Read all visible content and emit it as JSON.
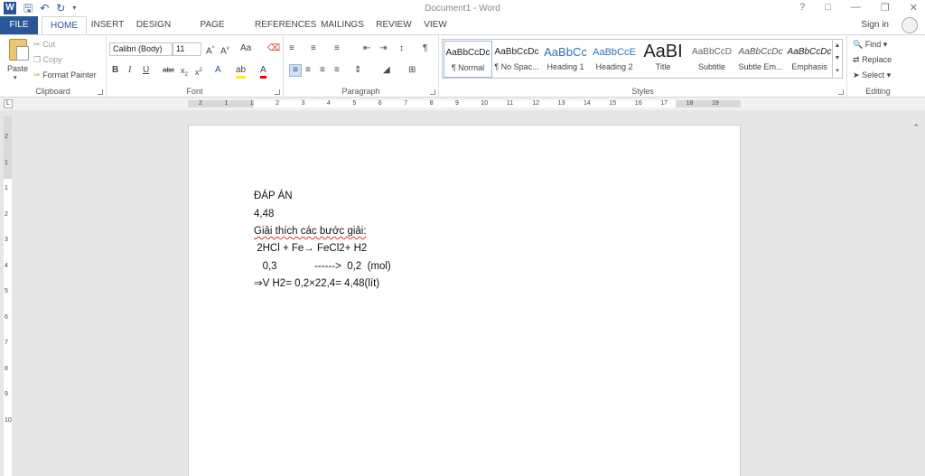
{
  "window": {
    "title": "Document1 - Word",
    "help": "?",
    "sign_in": "Sign in"
  },
  "qat": {
    "app_icon": "W",
    "save_icon": "save-icon",
    "undo_icon": "undo-icon",
    "redo_icon": "redo-icon"
  },
  "tabs": [
    "FILE",
    "HOME",
    "INSERT",
    "DESIGN",
    "PAGE LAYOUT",
    "REFERENCES",
    "MAILINGS",
    "REVIEW",
    "VIEW"
  ],
  "clipboard": {
    "paste": "Paste",
    "cut": "Cut",
    "copy": "Copy",
    "format_painter": "Format Painter",
    "label": "Clipboard"
  },
  "font": {
    "name": "Calibri (Body)",
    "size": "11",
    "label": "Font",
    "change_case": "Aa"
  },
  "paragraph": {
    "label": "Paragraph"
  },
  "styles": {
    "label": "Styles",
    "items": [
      {
        "preview": "AaBbCcDc",
        "name": "¶ Normal"
      },
      {
        "preview": "AaBbCcDc",
        "name": "¶ No Spac..."
      },
      {
        "preview": "AaBbCc",
        "name": "Heading 1"
      },
      {
        "preview": "AaBbCcE",
        "name": "Heading 2"
      },
      {
        "preview": "AaBI",
        "name": "Title"
      },
      {
        "preview": "AaBbCcD",
        "name": "Subtitle"
      },
      {
        "preview": "AaBbCcDc",
        "name": "Subtle Em..."
      },
      {
        "preview": "AaBbCcDc",
        "name": "Emphasis"
      }
    ]
  },
  "editing": {
    "find": "Find",
    "replace": "Replace",
    "select": "Select",
    "label": "Editing"
  },
  "ruler": {
    "ticks": [
      "2",
      "1",
      "1",
      "2",
      "3",
      "4",
      "5",
      "6",
      "7",
      "8",
      "9",
      "10",
      "11",
      "12",
      "13",
      "14",
      "15",
      "16",
      "17",
      "18",
      "19"
    ],
    "vticks": [
      "2",
      "1",
      "1",
      "2",
      "3",
      "4",
      "5",
      "6",
      "7",
      "8",
      "9",
      "10"
    ]
  },
  "document": {
    "lines": [
      "ĐÁP ÁN",
      "4,48",
      "Giải thích các bước giải:",
      " 2HCl + Fe→ FeCl2+ H2",
      "   0,3             ------>  0,2  (mol)",
      "⇒V H2= 0,2×22,4= 4,48(lít)"
    ]
  }
}
